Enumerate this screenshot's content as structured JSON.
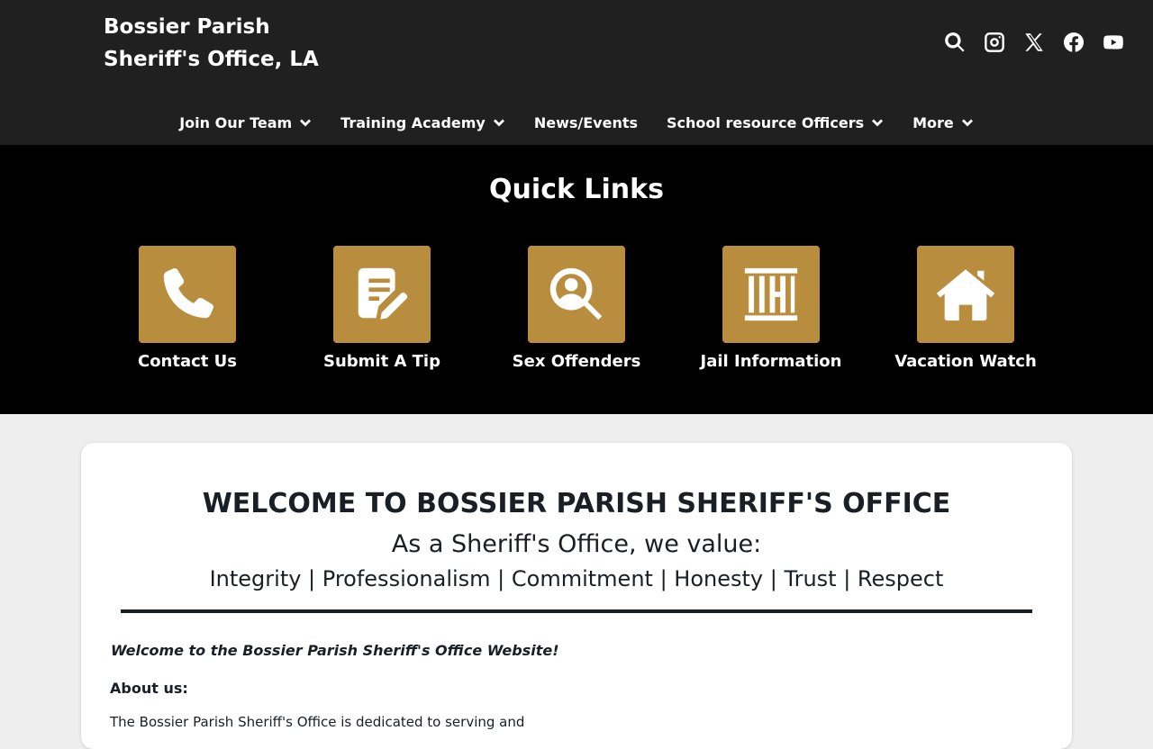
{
  "header": {
    "title_line1": "Bossier Parish",
    "title_line2": "Sheriff's Office, LA",
    "background": "#202020"
  },
  "social_icons": [
    "search-icon",
    "instagram-icon",
    "x-icon",
    "facebook-icon",
    "youtube-icon"
  ],
  "nav": {
    "items": [
      {
        "label": "Join Our Team",
        "dropdown": true
      },
      {
        "label": "Training Academy",
        "dropdown": true
      },
      {
        "label": "News/Events",
        "dropdown": false
      },
      {
        "label": "School resource Officers",
        "dropdown": true
      },
      {
        "label": "More",
        "dropdown": true
      }
    ]
  },
  "quick_links": {
    "title": "Quick Links",
    "accent": "#b98d3e",
    "items": [
      {
        "label": "Contact Us",
        "icon": "phone-icon"
      },
      {
        "label": "Submit A Tip",
        "icon": "document-edit-icon"
      },
      {
        "label": "Sex Offenders",
        "icon": "person-search-icon"
      },
      {
        "label": "Jail Information",
        "icon": "jail-bars-icon"
      },
      {
        "label": "Vacation Watch",
        "icon": "house-icon"
      }
    ]
  },
  "welcome": {
    "title": "WELCOME TO BOSSIER PARISH SHERIFF'S OFFICE",
    "subtitle": "As a Sheriff's Office, we value:",
    "values": "Integrity | Professionalism | Commitment | Honesty | Trust | Respect",
    "intro": "Welcome to the Bossier Parish Sheriff's Office Website!",
    "about_heading": "About us:",
    "about_text": "The Bossier Parish Sheriff's Office is dedicated to serving and"
  }
}
